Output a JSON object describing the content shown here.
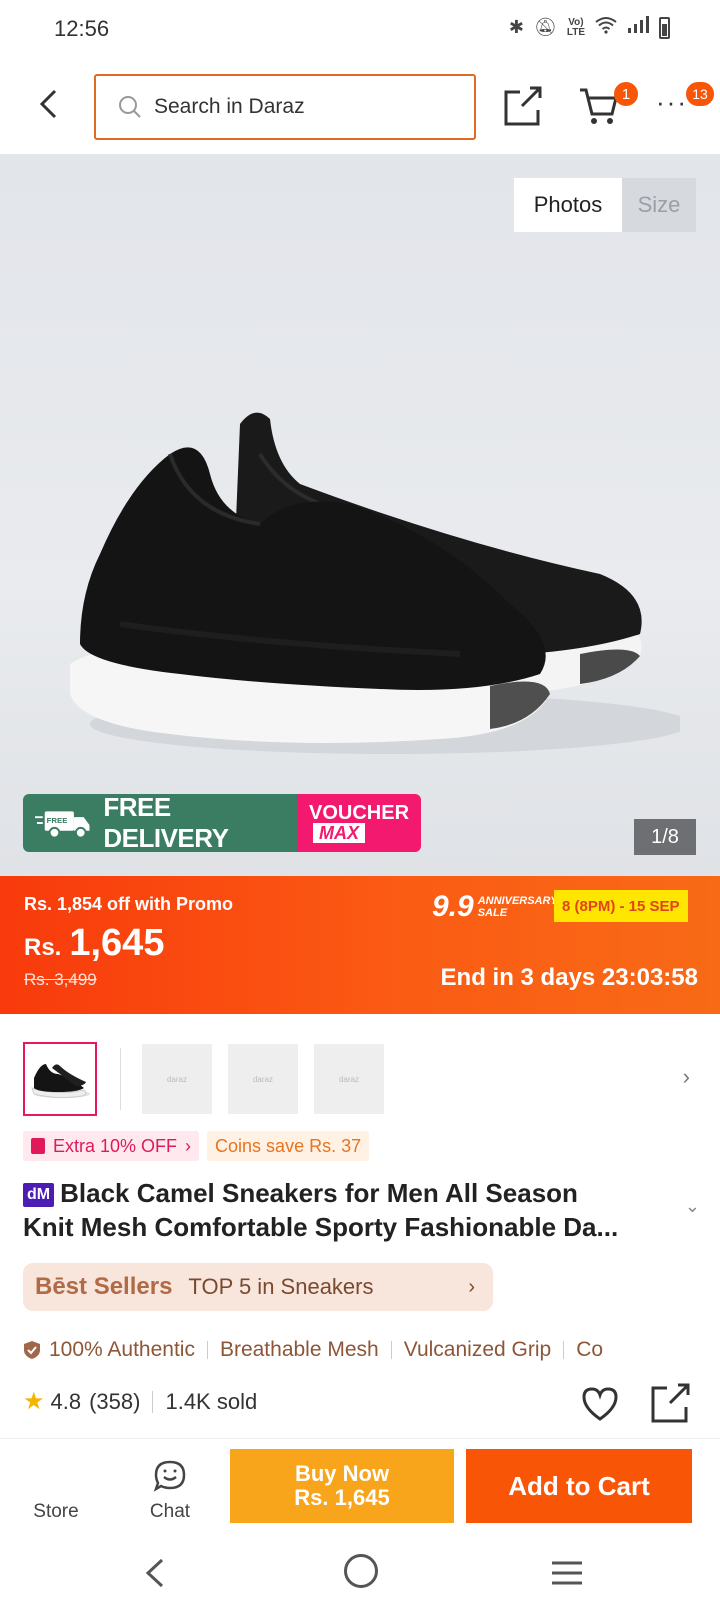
{
  "status_bar": {
    "time": "12:56",
    "lte_label": "Vo)\nLTE"
  },
  "header": {
    "search_placeholder": "Search in Daraz",
    "cart_count": "1",
    "more_count": "13"
  },
  "gallery": {
    "tab_photos": "Photos",
    "tab_size": "Size",
    "counter": "1/8",
    "free_delivery": "FREE DELIVERY",
    "free_badge": "FREE",
    "voucher_line1": "VOUCHER",
    "voucher_line2": "MAX",
    "thumb_placeholder": "daraz"
  },
  "price": {
    "promo_off": "Rs. 1,854 off with Promo",
    "currency": "Rs.",
    "current": "1,645",
    "original": "Rs. 3,499",
    "sale_number": "9.9",
    "sale_label": "ANNIVERSARY SALE",
    "sale_dates": "8 (8PM) - 15 SEP",
    "countdown": "End in 3 days 23:03:58"
  },
  "tags": {
    "extra": "Extra 10% OFF",
    "coins": "Coins save Rs. 37"
  },
  "product": {
    "badge": "dM",
    "title_line1": "Black Camel Sneakers for Men All Season",
    "title_line2": "Knit Mesh Comfortable Sporty Fashionable Da..."
  },
  "bestseller": {
    "brand": "Bēst Sellers",
    "text": "TOP 5 in Sneakers"
  },
  "highlights": [
    "100% Authentic",
    "Breathable Mesh",
    "Vulcanized Grip",
    "Co"
  ],
  "rating": {
    "score": "4.8",
    "count": "(358)",
    "sold": "1.4K sold"
  },
  "action_bar": {
    "store": "Store",
    "chat": "Chat",
    "buy_now": "Buy Now",
    "buy_price": "Rs. 1,645",
    "add_to_cart": "Add to Cart"
  },
  "colors": {
    "accent": "#f85606",
    "buy_now": "#f9a51c",
    "free_delivery": "#3a7d62",
    "voucher": "#f2196f"
  }
}
